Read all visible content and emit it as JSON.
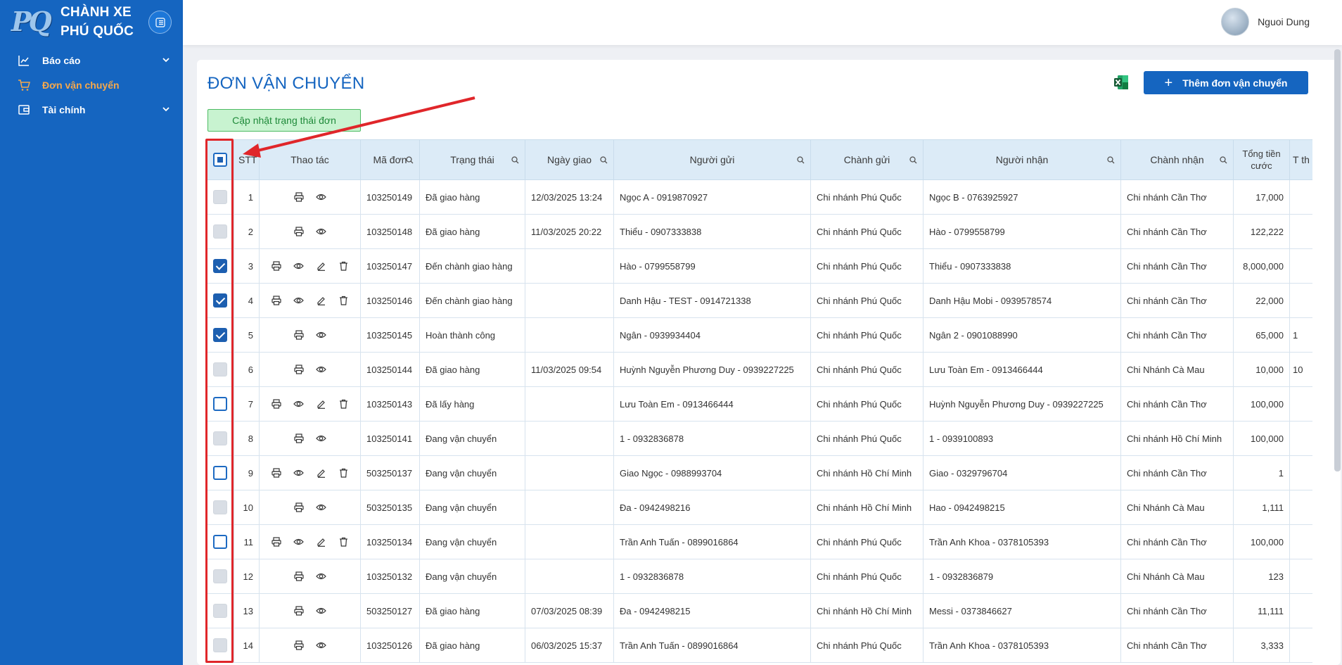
{
  "brand": {
    "line1": "CHÀNH XE",
    "line2": "PHÚ QUỐC",
    "logo_text": "PQ"
  },
  "nav": [
    {
      "label": "Báo cáo",
      "icon": "chart-line-icon",
      "expandable": true,
      "active": false
    },
    {
      "label": "Đơn vận chuyển",
      "icon": "cart-icon",
      "expandable": false,
      "active": true
    },
    {
      "label": "Tài chính",
      "icon": "wallet-icon",
      "expandable": true,
      "active": false
    }
  ],
  "user": {
    "name": "Nguoi Dung"
  },
  "page": {
    "title": "ĐƠN VẬN CHUYỂN",
    "add_button": "Thêm đơn vận chuyển",
    "update_status_button": "Cập nhật trạng thái đơn"
  },
  "colors": {
    "primary": "#1565c0",
    "active_nav": "#f5a84b",
    "annotation": "#e0262a",
    "success_bg": "#c8f3d0"
  },
  "table": {
    "headers": [
      "STT",
      "Thao tác",
      "Mã đơn",
      "Trạng thái",
      "Ngày giao",
      "Người gửi",
      "Chành gửi",
      "Người nhận",
      "Chành nhận",
      "Tổng tiền cước",
      "T th"
    ],
    "rows": [
      {
        "checkbox": "disabled",
        "stt": "1",
        "actions": [
          "print",
          "view"
        ],
        "code": "103250149",
        "status": "Đã giao hàng",
        "date": "12/03/2025 13:24",
        "sender": "Ngọc A - 0919870927",
        "from": "Chi nhánh Phú Quốc",
        "receiver": "Ngọc B - 0763925927",
        "to": "Chi nhánh Cần Thơ",
        "total": "17,000",
        "extra": ""
      },
      {
        "checkbox": "disabled",
        "stt": "2",
        "actions": [
          "print",
          "view"
        ],
        "code": "103250148",
        "status": "Đã giao hàng",
        "date": "11/03/2025 20:22",
        "sender": "Thiểu - 0907333838",
        "from": "Chi nhánh Phú Quốc",
        "receiver": "Hào - 0799558799",
        "to": "Chi nhánh Cần Thơ",
        "total": "122,222",
        "extra": ""
      },
      {
        "checkbox": "checked",
        "stt": "3",
        "actions": [
          "print",
          "view",
          "edit",
          "delete"
        ],
        "code": "103250147",
        "status": "Đến chành giao hàng",
        "date": "",
        "sender": "Hào - 0799558799",
        "from": "Chi nhánh Phú Quốc",
        "receiver": "Thiểu - 0907333838",
        "to": "Chi nhánh Cần Thơ",
        "total": "8,000,000",
        "extra": ""
      },
      {
        "checkbox": "checked",
        "stt": "4",
        "actions": [
          "print",
          "view",
          "edit",
          "delete"
        ],
        "code": "103250146",
        "status": "Đến chành giao hàng",
        "date": "",
        "sender": "Danh Hậu - TEST - 0914721338",
        "from": "Chi nhánh Phú Quốc",
        "receiver": "Danh Hậu Mobi - 0939578574",
        "to": "Chi nhánh Cần Thơ",
        "total": "22,000",
        "extra": ""
      },
      {
        "checkbox": "checked",
        "stt": "5",
        "actions": [
          "print",
          "view"
        ],
        "code": "103250145",
        "status": "Hoàn thành công",
        "date": "",
        "sender": "Ngân - 0939934404",
        "from": "Chi nhánh Phú Quốc",
        "receiver": "Ngân 2 - 0901088990",
        "to": "Chi nhánh Cần Thơ",
        "total": "65,000",
        "extra": "1"
      },
      {
        "checkbox": "disabled",
        "stt": "6",
        "actions": [
          "print",
          "view"
        ],
        "code": "103250144",
        "status": "Đã giao hàng",
        "date": "11/03/2025 09:54",
        "sender": "Huỳnh Nguyễn Phương Duy - 0939227225",
        "from": "Chi nhánh Phú Quốc",
        "receiver": "Lưu Toàn Em - 0913466444",
        "to": "Chi Nhánh Cà Mau",
        "total": "10,000",
        "extra": "10"
      },
      {
        "checkbox": "empty",
        "stt": "7",
        "actions": [
          "print",
          "view",
          "edit",
          "delete"
        ],
        "code": "103250143",
        "status": "Đã lấy hàng",
        "date": "",
        "sender": "Lưu Toàn Em - 0913466444",
        "from": "Chi nhánh Phú Quốc",
        "receiver": "Huỳnh Nguyễn Phương Duy - 0939227225",
        "to": "Chi nhánh Cần Thơ",
        "total": "100,000",
        "extra": ""
      },
      {
        "checkbox": "disabled",
        "stt": "8",
        "actions": [
          "print",
          "view"
        ],
        "code": "103250141",
        "status": "Đang vận chuyển",
        "date": "",
        "sender": "1 - 0932836878",
        "from": "Chi nhánh Phú Quốc",
        "receiver": "1 - 0939100893",
        "to": "Chi nhánh Hồ Chí Minh",
        "total": "100,000",
        "extra": ""
      },
      {
        "checkbox": "empty",
        "stt": "9",
        "actions": [
          "print",
          "view",
          "edit",
          "delete"
        ],
        "code": "503250137",
        "status": "Đang vận chuyển",
        "date": "",
        "sender": "Giao Ngọc - 0988993704",
        "from": "Chi nhánh Hồ Chí Minh",
        "receiver": "Giao - 0329796704",
        "to": "Chi nhánh Cần Thơ",
        "total": "1",
        "extra": ""
      },
      {
        "checkbox": "disabled",
        "stt": "10",
        "actions": [
          "print",
          "view"
        ],
        "code": "503250135",
        "status": "Đang vận chuyển",
        "date": "",
        "sender": "Đa - 0942498216",
        "from": "Chi nhánh Hồ Chí Minh",
        "receiver": "Hao - 0942498215",
        "to": "Chi Nhánh Cà Mau",
        "total": "1,111",
        "extra": ""
      },
      {
        "checkbox": "empty",
        "stt": "11",
        "actions": [
          "print",
          "view",
          "edit",
          "delete"
        ],
        "code": "103250134",
        "status": "Đang vận chuyển",
        "date": "",
        "sender": "Trần Anh Tuấn - 0899016864",
        "from": "Chi nhánh Phú Quốc",
        "receiver": "Trần Anh Khoa - 0378105393",
        "to": "Chi nhánh Cần Thơ",
        "total": "100,000",
        "extra": ""
      },
      {
        "checkbox": "disabled",
        "stt": "12",
        "actions": [
          "print",
          "view"
        ],
        "code": "103250132",
        "status": "Đang vận chuyển",
        "date": "",
        "sender": "1 - 0932836878",
        "from": "Chi nhánh Phú Quốc",
        "receiver": "1 - 0932836879",
        "to": "Chi Nhánh Cà Mau",
        "total": "123",
        "extra": ""
      },
      {
        "checkbox": "disabled",
        "stt": "13",
        "actions": [
          "print",
          "view"
        ],
        "code": "503250127",
        "status": "Đã giao hàng",
        "date": "07/03/2025 08:39",
        "sender": "Đa - 0942498215",
        "from": "Chi nhánh Hồ Chí Minh",
        "receiver": "Messi - 0373846627",
        "to": "Chi nhánh Cần Thơ",
        "total": "11,111",
        "extra": ""
      },
      {
        "checkbox": "disabled",
        "stt": "14",
        "actions": [
          "print",
          "view"
        ],
        "code": "103250126",
        "status": "Đã giao hàng",
        "date": "06/03/2025 15:37",
        "sender": "Trần Anh Tuấn - 0899016864",
        "from": "Chi nhánh Phú Quốc",
        "receiver": "Trần Anh Khoa - 0378105393",
        "to": "Chi nhánh Cần Thơ",
        "total": "3,333",
        "extra": ""
      }
    ]
  }
}
